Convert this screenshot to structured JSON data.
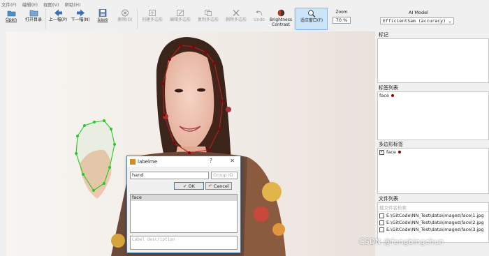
{
  "menubar": [
    "文件(F)",
    "编辑(E)",
    "视图(V)",
    "帮助(H)"
  ],
  "toolbar": {
    "open": "Open",
    "open_dir": "打开目录",
    "prev": "上一幅(P)",
    "next": "下一幅(N)",
    "save": "Save",
    "delete": "删除(D)",
    "create_polygon": "创建多边形",
    "edit_polygon": "编辑多边形",
    "copy_polygon": "复制多边形",
    "delete_polygon": "删除多边形",
    "undo": "Undo",
    "brightness_1": "Brightness",
    "brightness_2": "Contrast",
    "fit_window": "适应窗口(F)",
    "zoom_label": "Zoom",
    "zoom_value": "70 %"
  },
  "ai_model": {
    "label": "AI Model",
    "selected": "EfficientSam (accuracy)"
  },
  "docks": {
    "flags_title": "标记",
    "label_list_title": "标签列表",
    "label_list_items": [
      {
        "name": "face",
        "color": "#8b0000"
      }
    ],
    "polygon_labels_title": "多边形标签",
    "polygon_labels_items": [
      {
        "name": "face",
        "checked": true,
        "color": "#8b0000"
      }
    ],
    "file_list_title": "文件列表",
    "file_search_placeholder": "搜文件名检索",
    "files": [
      "E:\\GitCode\\NN_Test\\data\\images\\face\\1.jpg",
      "E:\\GitCode\\NN_Test\\data\\images\\face\\2.jpg",
      "E:\\GitCode\\NN_Test\\data\\images\\face\\3.jpg"
    ]
  },
  "dialog": {
    "title": "labelme",
    "help": "?",
    "close": "✕",
    "label_value": "hand",
    "group_id_placeholder": "Group ID",
    "ok": "OK",
    "cancel": "Cancel",
    "list_items": [
      "face"
    ],
    "description_placeholder": "Label description"
  },
  "watermark": "CSDN @fengbingchun",
  "colors": {
    "face_polygon": "#b22222",
    "hand_polygon": "#22cc22",
    "active_tool_bg": "#cce4f7",
    "dialog_border": "#3c7fb1"
  }
}
